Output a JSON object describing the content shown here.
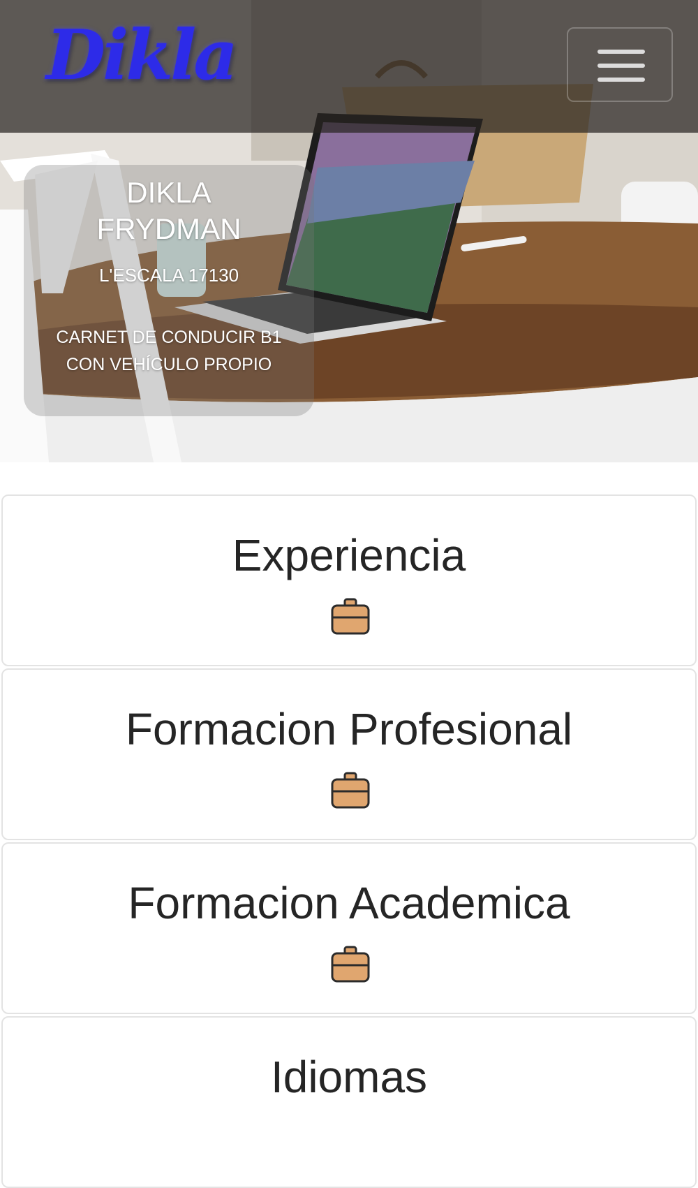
{
  "navbar": {
    "brand": "Dikla",
    "menu_icon": "hamburger-menu-icon"
  },
  "hero": {
    "name_line1": "DIKLA",
    "name_line2": "FRYDMAN",
    "location": "L'ESCALA 17130",
    "license_line1": "CARNET DE CONDUCIR B1",
    "license_line2": "CON VEHÍCULO PROPIO"
  },
  "sections": [
    {
      "title": "Experiencia",
      "icon": "briefcase-icon"
    },
    {
      "title": "Formacion Profesional",
      "icon": "briefcase-icon"
    },
    {
      "title": "Formacion Academica",
      "icon": "briefcase-icon"
    },
    {
      "title": "Idiomas"
    }
  ],
  "colors": {
    "brand": "#2d2be8",
    "briefcase_fill": "#e0a66f",
    "briefcase_stroke": "#2b2b2b",
    "title_text": "#252525"
  }
}
